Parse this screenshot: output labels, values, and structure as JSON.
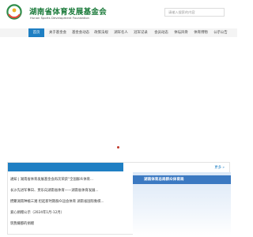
{
  "brand": {
    "title": "湖南省体育发展基金会",
    "subtitle": "Hunan Sports Development Foundation"
  },
  "search": {
    "placeholder": "请输入搜索的内容"
  },
  "nav": {
    "items": [
      "首页",
      "关于基金会",
      "基金会动态",
      "政策法规",
      "湖军名人",
      "冠军记录",
      "会员动态",
      "体坛风骨",
      "体育博物",
      "公示公告"
    ],
    "active_index": 0
  },
  "news": {
    "items": [
      "通知 | 湖南省体育发展基金会再次荣获“全国群众体育...",
      "长沙先进军事日、贾乐向湖南省体育——湖南省体育发展...",
      "攒聚湖南种植三湘 担起新时期群众运会体育 湖南省国际象棋...",
      "爱心捐赠公示（2024年1月-12月）",
      "筑我耀都的捐赠"
    ]
  },
  "right_panel": {
    "more_label": "更多 »",
    "photo_caption": "湖南体育总局群众体育局"
  }
}
